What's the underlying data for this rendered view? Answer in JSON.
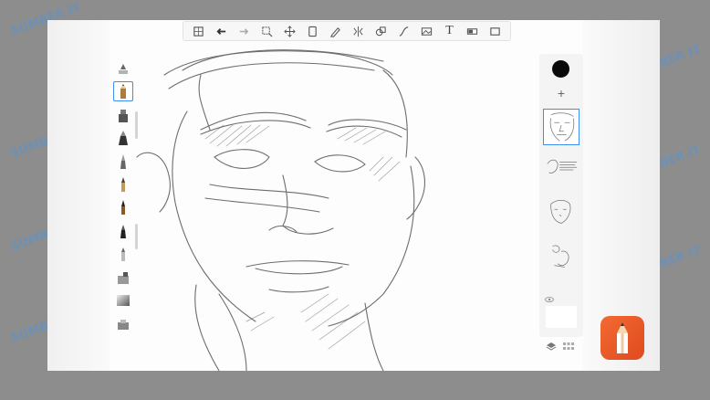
{
  "app": {
    "name": "Autodesk SketchBook"
  },
  "colors": {
    "accent": "#3d8ef0",
    "current_color": "#0a0a0a",
    "logo": "#f26a33",
    "watermark": "#4696e6"
  },
  "toolbar": {
    "items": [
      {
        "id": "gallery",
        "icon": "gallery-icon"
      },
      {
        "id": "undo",
        "icon": "undo-icon"
      },
      {
        "id": "redo",
        "icon": "redo-icon"
      },
      {
        "id": "select",
        "icon": "selection-icon"
      },
      {
        "id": "transform",
        "icon": "move-icon"
      },
      {
        "id": "canvas",
        "icon": "canvas-icon"
      },
      {
        "id": "pencil",
        "icon": "pencil-icon"
      },
      {
        "id": "symmetry",
        "icon": "symmetry-icon"
      },
      {
        "id": "shapes",
        "icon": "shapes-icon"
      },
      {
        "id": "curve",
        "icon": "curve-icon"
      },
      {
        "id": "image",
        "icon": "image-icon"
      },
      {
        "id": "text",
        "icon": "text-icon",
        "label": "T"
      },
      {
        "id": "copic",
        "icon": "copic-icon"
      },
      {
        "id": "fullscreen",
        "icon": "fullscreen-icon"
      }
    ]
  },
  "brushes": {
    "items": [
      {
        "name": "brush-settings",
        "icon": "brush-settings-icon"
      },
      {
        "name": "pencil",
        "icon": "pencil-brush-icon",
        "selected": true
      },
      {
        "name": "marker",
        "icon": "marker-brush-icon"
      },
      {
        "name": "chisel",
        "icon": "chisel-brush-icon"
      },
      {
        "name": "ink-pen",
        "icon": "ink-brush-icon"
      },
      {
        "name": "ballpoint",
        "icon": "ballpoint-brush-icon"
      },
      {
        "name": "paint-brush",
        "icon": "paint-brush-icon"
      },
      {
        "name": "fine-marker",
        "icon": "fine-marker-icon"
      },
      {
        "name": "tech-pen",
        "icon": "tech-pen-icon"
      },
      {
        "name": "airbrush",
        "icon": "airbrush-icon"
      },
      {
        "name": "gradient",
        "icon": "gradient-icon"
      },
      {
        "name": "eraser",
        "icon": "eraser-icon"
      }
    ]
  },
  "layers": {
    "add_label": "+",
    "items": [
      {
        "name": "layer-1",
        "selected": true
      },
      {
        "name": "layer-2",
        "selected": false
      },
      {
        "name": "layer-3",
        "selected": false
      },
      {
        "name": "layer-4",
        "selected": false
      }
    ]
  },
  "watermark": {
    "text": "SUMBER IT"
  }
}
